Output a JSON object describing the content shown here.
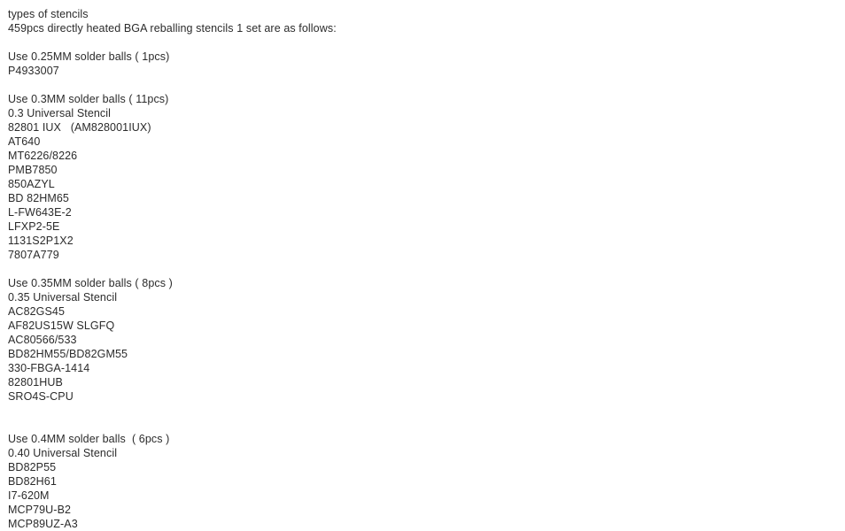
{
  "document": {
    "title_lines": [
      "types of stencils",
      "459pcs directly heated BGA reballing stencils 1 set are as follows:"
    ],
    "sections": [
      {
        "heading": "Use 0.25MM solder balls ( 1pcs)",
        "items": [
          "P4933007"
        ]
      },
      {
        "heading": "Use 0.3MM solder balls ( 11pcs)",
        "items": [
          "0.3 Universal Stencil",
          "82801 IUX   (AM828001IUX)",
          "AT640",
          "MT6226/8226",
          "PMB7850",
          "850AZYL",
          "BD 82HM65",
          "L-FW643E-2",
          "LFXP2-5E",
          "1131S2P1X2",
          "7807A779"
        ]
      },
      {
        "heading": "Use 0.35MM solder balls ( 8pcs )",
        "items": [
          "0.35 Universal Stencil",
          "AC82GS45",
          "AF82US15W SLGFQ",
          "AC80566/533",
          "BD82HM55/BD82GM55",
          "330-FBGA-1414",
          "82801HUB",
          "SRO4S-CPU"
        ]
      },
      {
        "heading": "Use 0.4MM solder balls  ( 6pcs )",
        "items": [
          "0.40 Universal Stencil",
          "BD82P55",
          "BD82H61",
          "I7-620M",
          "MCP79U-B2",
          "MCP89UZ-A3"
        ]
      }
    ]
  },
  "style": {
    "text_color": "#2b2b2b",
    "background_color": "#ffffff"
  }
}
